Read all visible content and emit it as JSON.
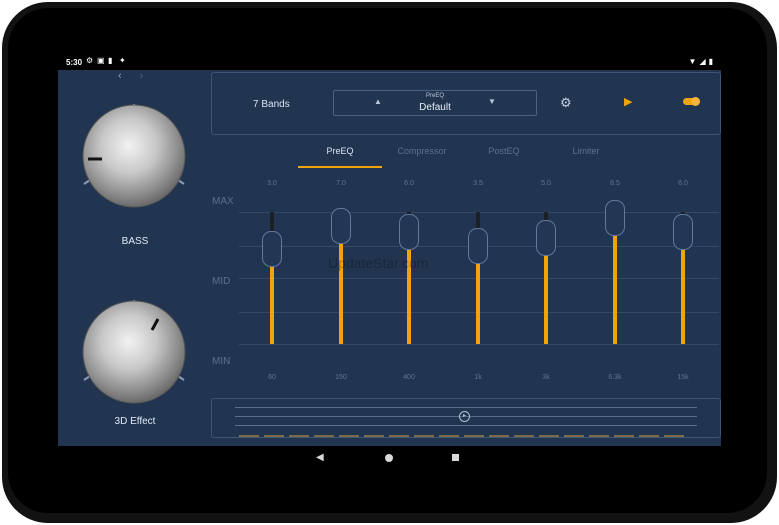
{
  "status_bar": {
    "time": "5:30",
    "left_icons": [
      "settings-icon",
      "a-icon",
      "sd-card-icon",
      "location-icon"
    ],
    "right_icons": [
      "wifi-icon",
      "signal-icon",
      "battery-icon"
    ]
  },
  "knobs": [
    {
      "label": "BASS",
      "level": 0.0
    },
    {
      "label": "3D Effect",
      "level": 0.85
    }
  ],
  "toolbar": {
    "bands_label": "7 Bands",
    "preset_caption": "PreEQ",
    "preset_value": "Default",
    "icons": {
      "prev": "chevron-up-icon",
      "next": "chevron-down-icon",
      "settings": "gear-icon",
      "play": "play-icon",
      "power": "toggle-switch"
    }
  },
  "tabs": [
    {
      "label": "PreEQ",
      "active": true
    },
    {
      "label": "Compressor",
      "active": false
    },
    {
      "label": "PostEQ",
      "active": false
    },
    {
      "label": "Limiter",
      "active": false
    }
  ],
  "eq": {
    "level_labels": {
      "max": "MAX",
      "mid": "MID",
      "min": "MIN"
    },
    "bands": [
      {
        "freq": "60",
        "gain": "3.0",
        "level": 0.6
      },
      {
        "freq": "150",
        "gain": "7.0",
        "level": 0.77
      },
      {
        "freq": "400",
        "gain": "6.0",
        "level": 0.73
      },
      {
        "freq": "1k",
        "gain": "3.5",
        "level": 0.62
      },
      {
        "freq": "3k",
        "gain": "5.0",
        "level": 0.68
      },
      {
        "freq": "6.3k",
        "gain": "8.5",
        "level": 0.83
      },
      {
        "freq": "15k",
        "gain": "6.0",
        "level": 0.73
      }
    ]
  },
  "watermark": "UpdateStar.com",
  "accent_color": "#f0a30a",
  "background_color": "#213551"
}
